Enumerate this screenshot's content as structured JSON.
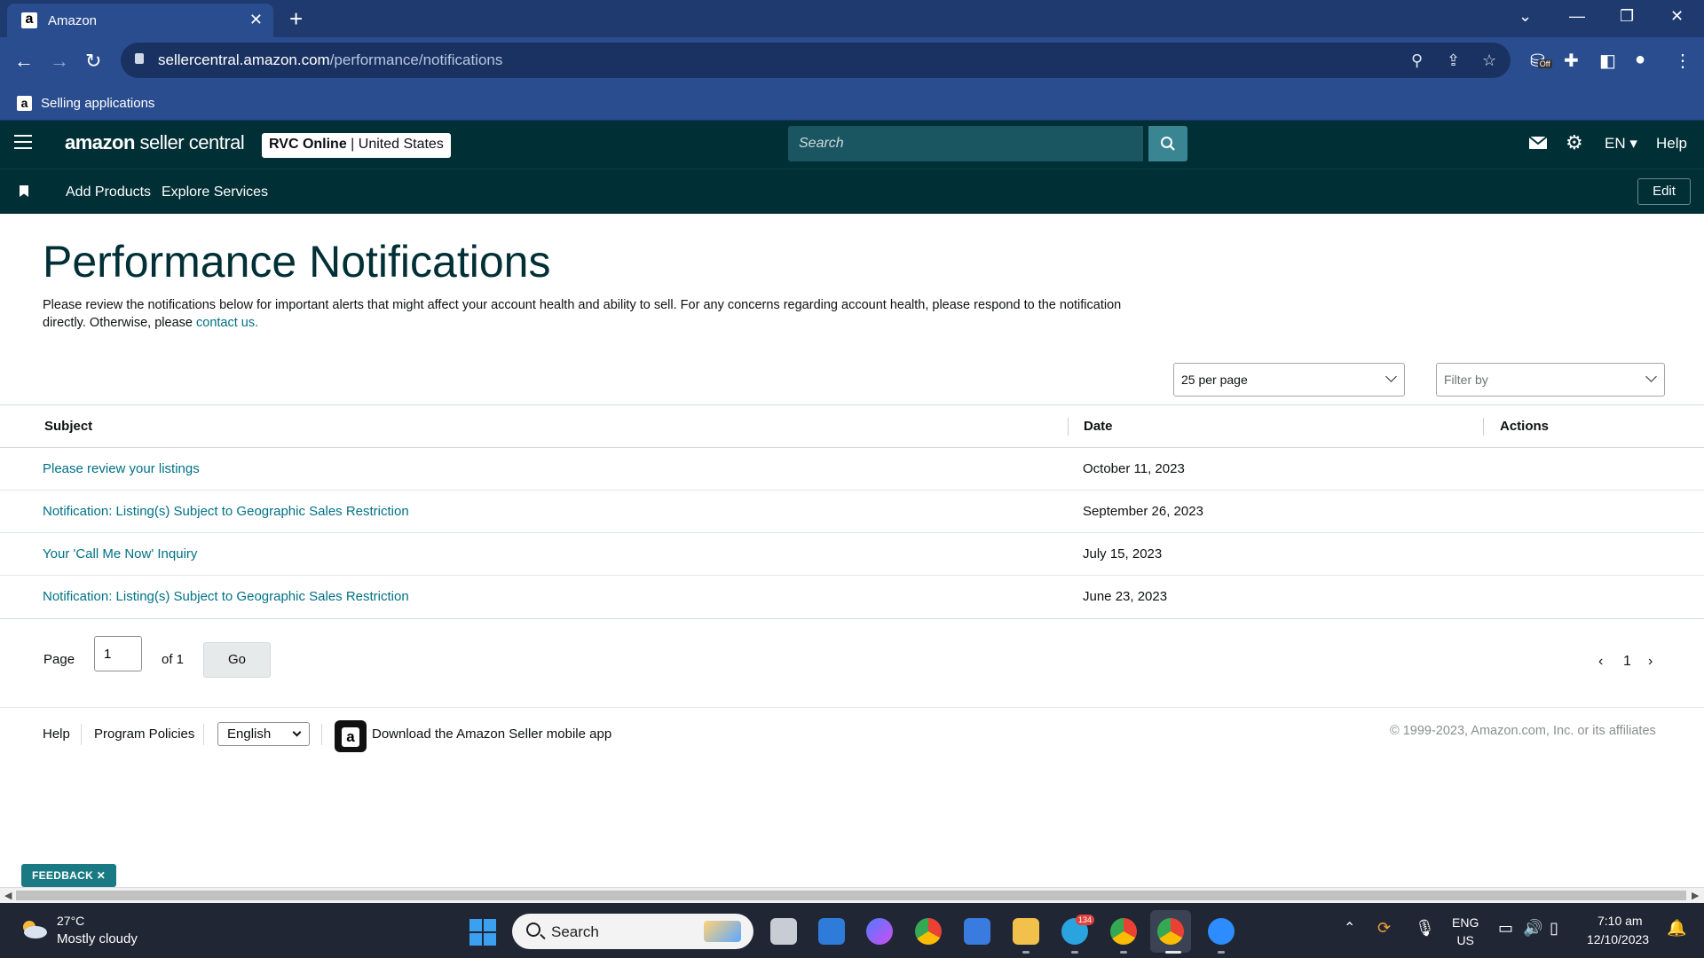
{
  "browser": {
    "tab_title": "Amazon",
    "tab_favicon": "a",
    "url_domain": "sellercentral.amazon.com",
    "url_path": "/performance/notifications",
    "bookmark_label": "Selling applications",
    "bookmark_favicon": "a",
    "extension_badge": "Off"
  },
  "header": {
    "logo_brand": "amazon",
    "logo_product": "seller central",
    "store_name": "RVC Online",
    "store_region": "United States",
    "search_placeholder": "Search",
    "lang": "EN",
    "help": "Help"
  },
  "subnav": {
    "links": [
      "Add Products",
      "Explore Services"
    ],
    "edit": "Edit"
  },
  "main": {
    "title": "Performance Notifications",
    "intro_text": "Please review the notifications below for important alerts that might affect your account health and ability to sell. For any concerns regarding account health, please respond to the notification directly. Otherwise, please ",
    "intro_link": "contact us.",
    "per_page": "25 per page",
    "filter_placeholder": "Filter by",
    "columns": {
      "subject": "Subject",
      "date": "Date",
      "actions": "Actions"
    },
    "rows": [
      {
        "subject": "Please review your listings",
        "date": "October 11, 2023"
      },
      {
        "subject": "Notification: Listing(s) Subject to Geographic Sales Restriction",
        "date": "September 26, 2023"
      },
      {
        "subject": "Your 'Call Me Now' Inquiry",
        "date": "July 15, 2023"
      },
      {
        "subject": "Notification: Listing(s) Subject to Geographic Sales Restriction",
        "date": "June 23, 2023"
      }
    ],
    "pager": {
      "page_label": "Page",
      "page_value": "1",
      "of_label": "of 1",
      "go": "Go",
      "current": "1"
    }
  },
  "footer": {
    "help": "Help",
    "policies": "Program Policies",
    "language": "English",
    "app_text": "Download the Amazon Seller mobile app",
    "copyright": "© 1999-2023, Amazon.com, Inc. or its affiliates"
  },
  "feedback": "FEEDBACK",
  "taskbar": {
    "temp": "27°C",
    "weather": "Mostly cloudy",
    "search": "Search",
    "telegram_badge": "134",
    "lang_top": "ENG",
    "lang_bottom": "US",
    "time": "7:10 am",
    "date": "12/10/2023"
  },
  "colors": {
    "browser_frame": "#2a4d8f",
    "seller_header": "#002f36",
    "link": "#007185",
    "title": "#002f36",
    "feedback": "#1a7a83"
  }
}
